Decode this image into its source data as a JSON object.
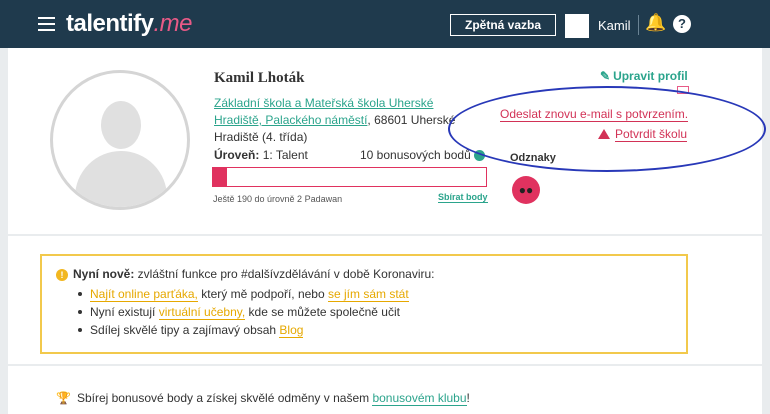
{
  "header": {
    "logo_main": "talentify",
    "logo_accent": ".me",
    "feedback_button": "Zpětná vazba",
    "username": "Kamil",
    "help_symbol": "?"
  },
  "profile": {
    "name": "Kamil Lhoták",
    "school_link": "Základní škola a Mateřská škola Uherské Hradiště, Palackého náměstí",
    "school_rest": ", 68601 Uherské Hradiště (4. třída)",
    "level_label": "Úroveň:",
    "level_value": "1: Talent",
    "bonus_points": "10 bonusových bodů",
    "progress_fraction": 0.05,
    "next_level_text": "Ještě 190 do úrovně 2 Padawan",
    "collect_label": "Sbírat body"
  },
  "actions": {
    "edit_profile": "Upravit profil",
    "resend_email": "Odeslat znovu e-mail s potvrzením.",
    "confirm_school": "Potvrdit školu",
    "badges_label": "Odznaky"
  },
  "news": {
    "title_bold": "Nyní nově:",
    "title_rest": " zvláštní funkce pro #dalšívzdělávání v době Koronaviru:",
    "items": [
      {
        "link1": "Najít online parťáka,",
        "text": " který mě podpoří, nebo ",
        "link2": "se jím sám stát"
      },
      {
        "text_before": "Nyní existují ",
        "link1": "virtuální učebny,",
        "text": " kde se můžete společně učit"
      },
      {
        "text_before": "Sdílej skvělé tipy a zajímavý obsah ",
        "link1": "Blog"
      }
    ]
  },
  "bonus_club": {
    "text": "Sbírej bonusové body a získej skvělé odměny v našem ",
    "link": "bonusovém klubu",
    "end": "!"
  },
  "colors": {
    "header_bg": "#1f3a4d",
    "teal": "#2ba48c",
    "red": "#d23256",
    "yellow": "#f2c94c",
    "annotation_blue": "#2838b8"
  }
}
